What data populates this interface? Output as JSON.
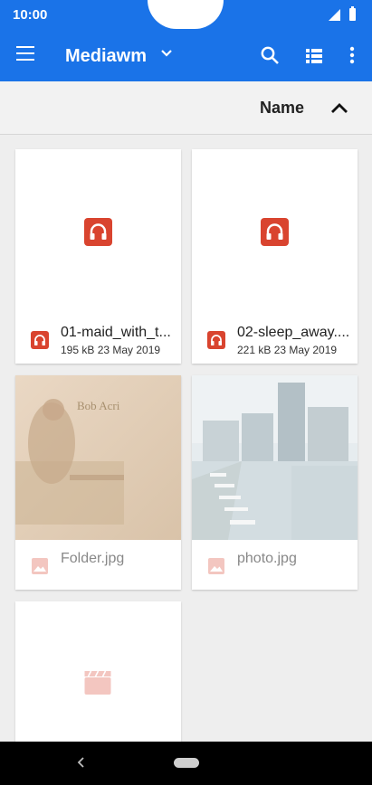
{
  "status_bar": {
    "time": "10:00"
  },
  "app_bar": {
    "title": "Mediawm",
    "icons": [
      "menu-icon",
      "chevron-down-icon",
      "search-icon",
      "list-view-icon",
      "more-vert-icon"
    ]
  },
  "sort": {
    "label": "Name",
    "direction_icon": "chevron-up-icon"
  },
  "files": [
    {
      "name": "01-maid_with_t...",
      "meta": "195 kB 23 May 2019",
      "type": "audio",
      "icon": "headphones-icon"
    },
    {
      "name": "02-sleep_away....",
      "meta": "221 kB 23 May 2019",
      "type": "audio",
      "icon": "headphones-icon"
    },
    {
      "name": "Folder.jpg",
      "meta": "",
      "type": "image",
      "icon": "image-icon",
      "thumbnail_text": [
        "Bob Acri"
      ]
    },
    {
      "name": "photo.jpg",
      "meta": "",
      "type": "image",
      "icon": "image-icon"
    },
    {
      "name": "",
      "meta": "",
      "type": "video",
      "icon": "clapperboard-icon"
    }
  ],
  "colors": {
    "accent": "#1a73e8",
    "audio_icon": "#d9442f",
    "faded_icon": "#f3c6c0"
  }
}
